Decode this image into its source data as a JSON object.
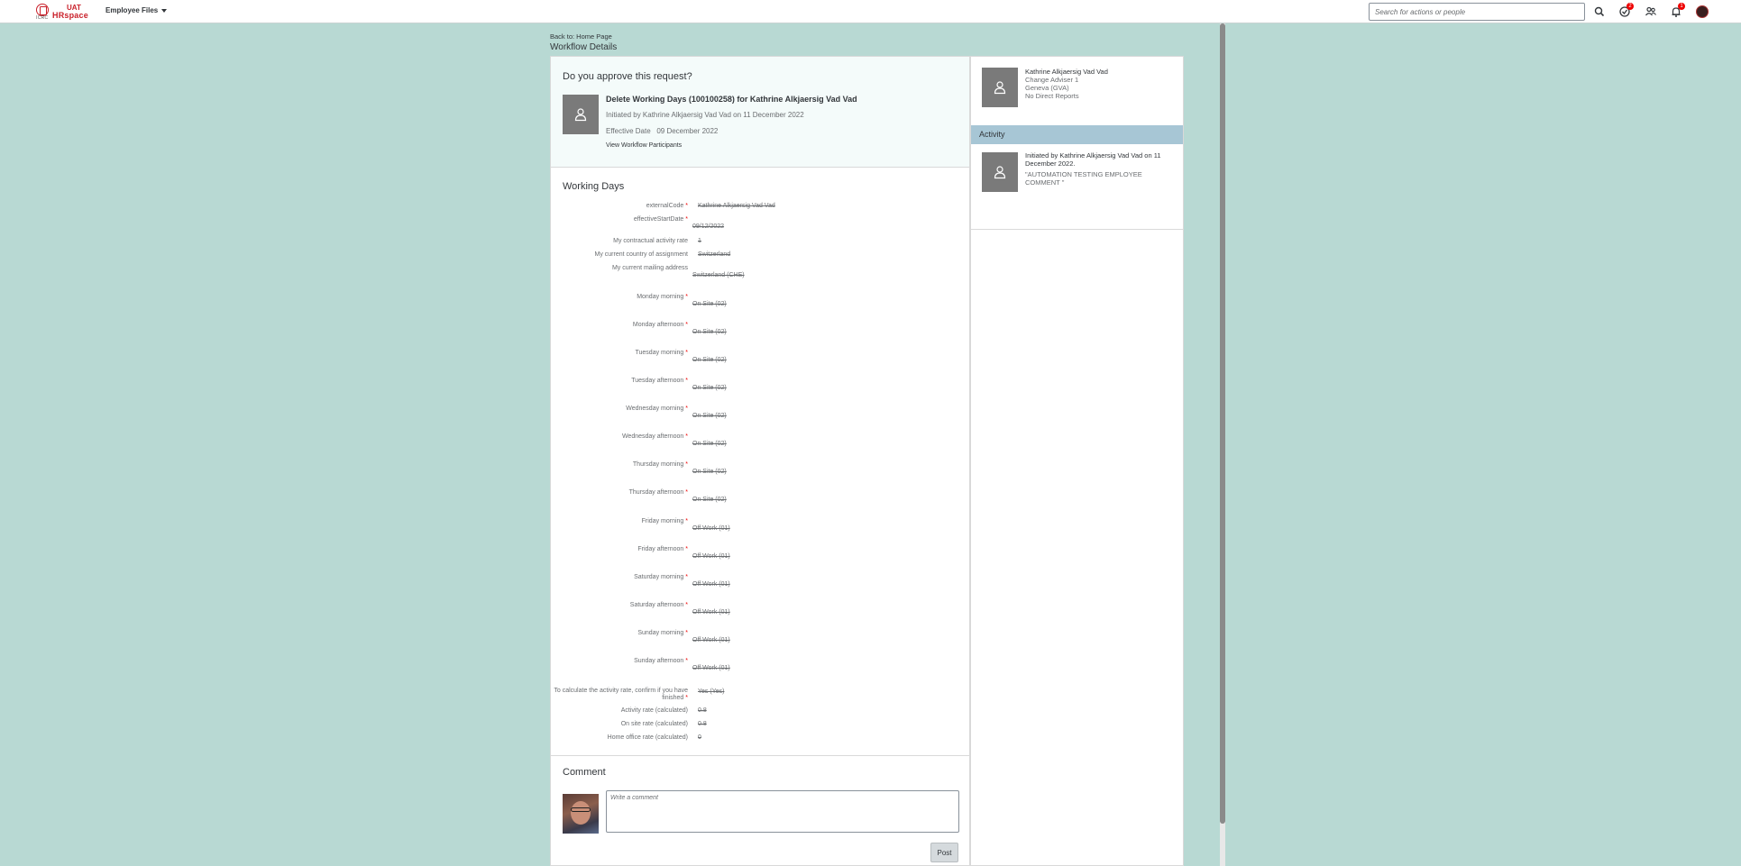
{
  "header": {
    "logo_org": "ICRC",
    "logo_env": "UAT",
    "logo_app": "HRspace",
    "menu_label": "Employee Files",
    "search_placeholder": "Search for actions or people",
    "approvals_badge": "2",
    "notifications_badge": "1"
  },
  "nav": {
    "back_link": "Back to: Home Page",
    "page_title": "Workflow Details"
  },
  "approval": {
    "question": "Do you approve this request?",
    "title": "Delete Working Days (100100258) for Kathrine Alkjaersig Vad Vad",
    "initiated": "Initiated by Kathrine Alkjaersig Vad Vad on 11 December 2022",
    "effective_label": "Effective Date",
    "effective_date": "09 December 2022",
    "participants_link": "View Workflow Participants"
  },
  "working_days": {
    "heading": "Working Days",
    "fields": [
      {
        "label": "externalCode",
        "required": true,
        "value": "Kathrine Alkjaersig Vad Vad"
      },
      {
        "label": "effectiveStartDate",
        "required": true,
        "value": "09/12/2022"
      },
      {
        "label": "My contractual activity rate",
        "required": false,
        "value": "1"
      },
      {
        "label": "My current country of assignment",
        "required": false,
        "value": "Switzerland"
      },
      {
        "label": "My current mailing address",
        "required": false,
        "value": "Switzerland (CHE)"
      },
      {
        "label": "Monday morning",
        "required": true,
        "value": "On Site (02)"
      },
      {
        "label": "Monday afternoon",
        "required": true,
        "value": "On Site (02)"
      },
      {
        "label": "Tuesday morning",
        "required": true,
        "value": "On Site (02)"
      },
      {
        "label": "Tuesday afternoon",
        "required": true,
        "value": "On Site (02)"
      },
      {
        "label": "Wednesday morning",
        "required": true,
        "value": "On Site (02)"
      },
      {
        "label": "Wednesday afternoon",
        "required": true,
        "value": "On Site (02)"
      },
      {
        "label": "Thursday morning",
        "required": true,
        "value": "On Site (02)"
      },
      {
        "label": "Thursday afternoon",
        "required": true,
        "value": "On Site (02)"
      },
      {
        "label": "Friday morning",
        "required": true,
        "value": "Off Work (01)"
      },
      {
        "label": "Friday afternoon",
        "required": true,
        "value": "Off Work (01)"
      },
      {
        "label": "Saturday morning",
        "required": true,
        "value": "Off Work (01)"
      },
      {
        "label": "Saturday afternoon",
        "required": true,
        "value": "Off Work (01)"
      },
      {
        "label": "Sunday morning",
        "required": true,
        "value": "Off Work (01)"
      },
      {
        "label": "Sunday afternoon",
        "required": true,
        "value": "Off Work (01)"
      },
      {
        "label": "To calculate the activity rate, confirm if you have finished",
        "required": true,
        "value": "Yes (Yes)"
      },
      {
        "label": "Activity rate (calculated)",
        "required": false,
        "value": "0.8"
      },
      {
        "label": "On site rate (calculated)",
        "required": false,
        "value": "0.8"
      },
      {
        "label": "Home office rate (calculated)",
        "required": false,
        "value": "0"
      }
    ]
  },
  "comment": {
    "heading": "Comment",
    "placeholder": "Write a comment",
    "post_label": "Post"
  },
  "side": {
    "name": "Kathrine Alkjaersig Vad Vad",
    "role": "Change Adviser 1",
    "location": "Geneva (GVA)",
    "reports": "No Direct Reports",
    "activity_heading": "Activity",
    "activity_text": "Initiated by Kathrine Alkjaersig Vad Vad on 11 December 2022.",
    "activity_comment": "\"AUTOMATION TESTING EMPLOYEE COMMENT \""
  },
  "colors": {
    "background": "#b8d9d3",
    "activity_header": "#a7c6d5",
    "required_marker": "#e00000"
  }
}
